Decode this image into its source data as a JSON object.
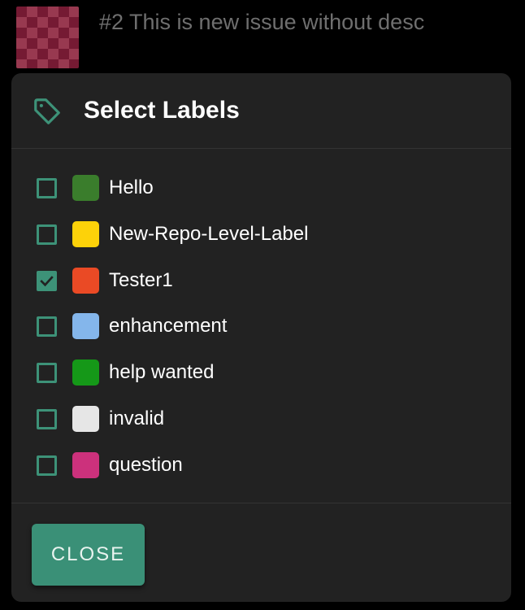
{
  "issue": {
    "title": "#2 This is new issue without desc"
  },
  "dialog": {
    "title": "Select Labels",
    "icon": "tag-icon",
    "close_label": "CLOSE",
    "accent_color": "#3d9278"
  },
  "labels": [
    {
      "name": "Hello",
      "color": "#3a7d2c",
      "checked": false
    },
    {
      "name": "New-Repo-Level-Label",
      "color": "#fdd209",
      "checked": false
    },
    {
      "name": "Tester1",
      "color": "#ea4a25",
      "checked": true
    },
    {
      "name": "enhancement",
      "color": "#84b6eb",
      "checked": false
    },
    {
      "name": "help wanted",
      "color": "#159818",
      "checked": false
    },
    {
      "name": "invalid",
      "color": "#e6e6e6",
      "checked": false
    },
    {
      "name": "question",
      "color": "#cc317c",
      "checked": false
    }
  ]
}
